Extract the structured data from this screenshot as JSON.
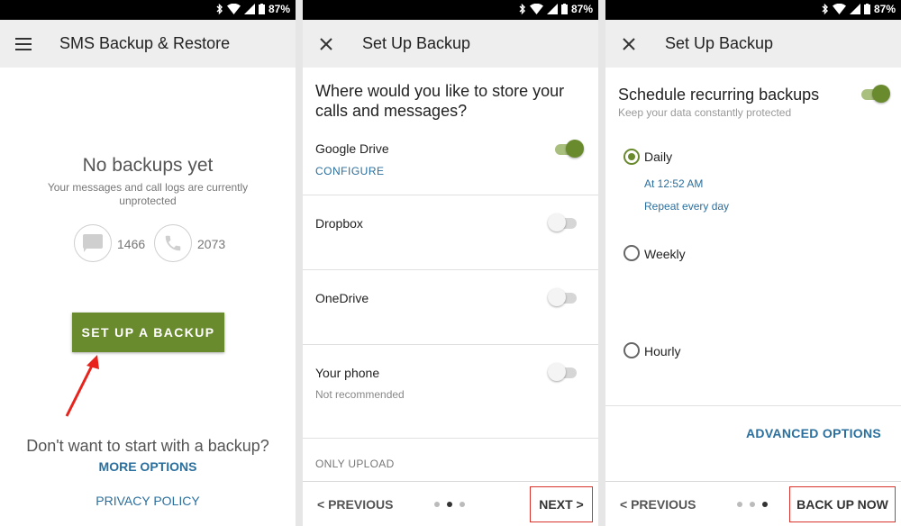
{
  "status": {
    "battery": "87%"
  },
  "panel1": {
    "title": "SMS Backup & Restore",
    "menu_icon": "hamburger-menu-icon",
    "empty_title": "No backups yet",
    "empty_subtitle": "Your messages and call logs are currently unprotected",
    "messages_count": "1466",
    "calls_count": "2073",
    "setup_button": "SET UP A BACKUP",
    "dont_want": "Don't want to start with a backup?",
    "more_options": "MORE OPTIONS",
    "privacy_policy": "PRIVACY POLICY"
  },
  "panel2": {
    "title": "Set Up Backup",
    "question": "Where would you like to store your calls and messages?",
    "options": [
      {
        "label": "Google Drive",
        "link": "CONFIGURE",
        "enabled": true
      },
      {
        "label": "Dropbox",
        "enabled": false
      },
      {
        "label": "OneDrive",
        "enabled": false
      },
      {
        "label": "Your phone",
        "sub": "Not recommended",
        "enabled": false
      }
    ],
    "only_upload": "ONLY UPLOAD",
    "previous": "< PREVIOUS",
    "next": "NEXT >",
    "page_index": 2,
    "page_total": 3
  },
  "panel3": {
    "title": "Set Up Backup",
    "schedule_title": "Schedule recurring backups",
    "schedule_subtitle": "Keep your data constantly protected",
    "schedule_enabled": true,
    "daily": "Daily",
    "daily_time": "At 12:52 AM",
    "daily_repeat": "Repeat every day",
    "weekly": "Weekly",
    "hourly": "Hourly",
    "selected": "Daily",
    "advanced_options": "ADVANCED OPTIONS",
    "previous": "< PREVIOUS",
    "back_up_now": "BACK UP NOW",
    "page_index": 3,
    "page_total": 3
  },
  "colors": {
    "accent_green": "#6a8a2e",
    "link_blue": "#2a6f9e",
    "highlight_red": "#d9332b"
  }
}
